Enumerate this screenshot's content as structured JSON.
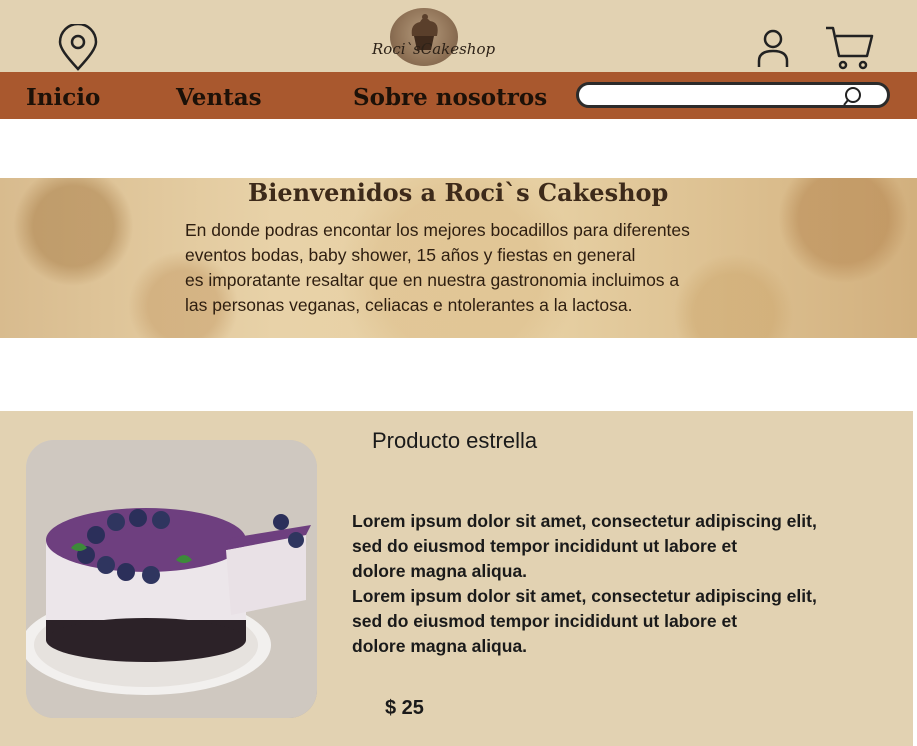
{
  "header": {
    "logo_text": "Roci`sCakeshop",
    "icons": [
      "location-pin-icon",
      "user-icon",
      "cart-icon",
      "search-icon"
    ]
  },
  "nav": {
    "items": [
      {
        "label": "Inicio"
      },
      {
        "label": "Ventas"
      },
      {
        "label": "Sobre nosotros"
      }
    ],
    "search_value": ""
  },
  "hero": {
    "title": "Bienvenidos a Roci`s Cakeshop",
    "lines": [
      "En donde podras encontar los mejores bocadillos para diferentes",
      "eventos bodas, baby shower, 15 años y fiestas en general",
      "es imporatante resaltar que en nuestra gastronomia incluimos a",
      "las personas veganas, celiacas e ntolerantes a la lactosa."
    ]
  },
  "featured": {
    "title": "Producto estrella",
    "lines": [
      "Lorem ipsum dolor sit amet, consectetur adipiscing elit,",
      "sed do eiusmod tempor incididunt ut labore et",
      "dolore magna aliqua.",
      "Lorem ipsum dolor sit amet, consectetur adipiscing elit,",
      "sed do eiusmod tempor incididunt ut labore et",
      "dolore magna aliqua."
    ],
    "price": "$ 25"
  },
  "colors": {
    "header_bg": "#e2d2b2",
    "nav_bg": "#a9582e",
    "featured_bg": "#e2d2b2"
  }
}
